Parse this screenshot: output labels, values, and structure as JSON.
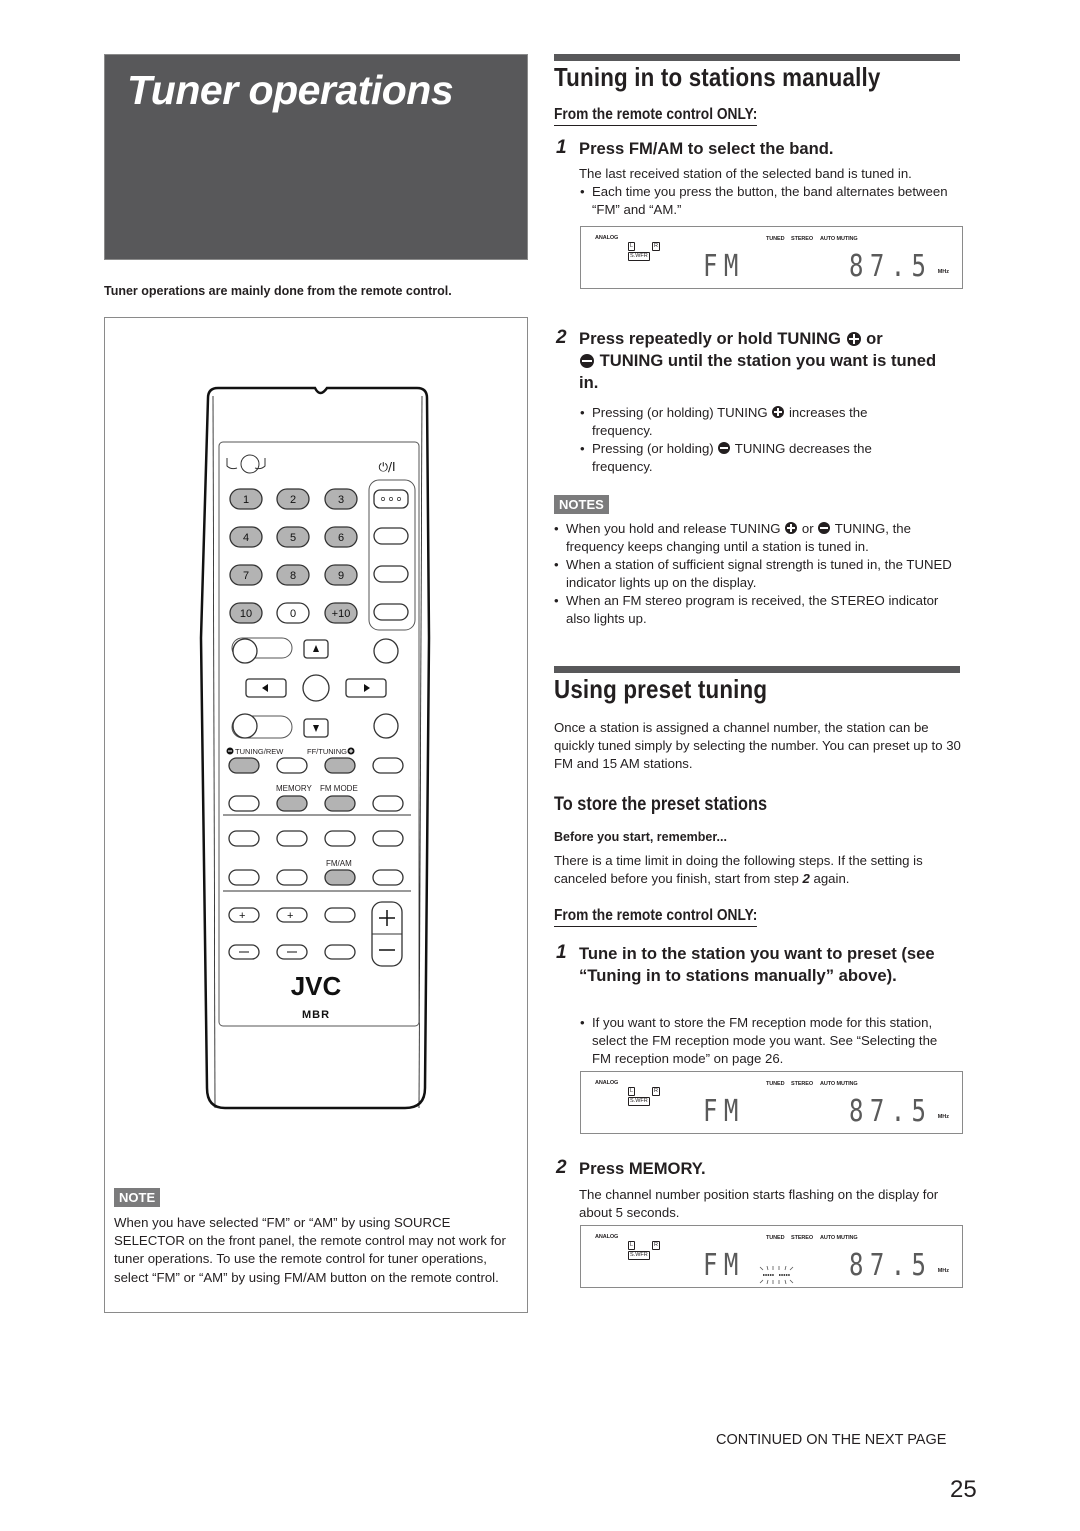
{
  "chapter": {
    "title": "Tuner operations",
    "caption": "Tuner operations are mainly done from the remote control."
  },
  "remote": {
    "power_label": "⏻/I",
    "numeric_keys": [
      "1",
      "2",
      "3",
      "4",
      "5",
      "6",
      "7",
      "8",
      "9",
      "10",
      "0",
      "+10"
    ],
    "labels": {
      "tuning_rew": "TUNING/REW",
      "ff_tuning": "FF/TUNING",
      "memory": "MEMORY",
      "fm_mode": "FM MODE",
      "fm_am": "FM/AM"
    },
    "brand": "JVC",
    "sub_brand": "MBR"
  },
  "remote_note": {
    "label": "NOTE",
    "text": "When you have selected “FM” or “AM” by using SOURCE SELECTOR on the front panel, the remote control may not work for tuner operations. To use the remote control for tuner operations, select “FM” or “AM” by using FM/AM button on the remote control."
  },
  "manual": {
    "heading": "Tuning in to stations manually",
    "subheading": "From the remote control ONLY:",
    "step1": {
      "num": "1",
      "title": "Press FM/AM to select the band.",
      "body": "The last received station of the selected band is tuned in.",
      "bullet": "Each time you press the button, the band alternates between “FM” and “AM.”"
    },
    "step2": {
      "num": "2",
      "title_a": "Press repeatedly or hold TUNING",
      "title_b": "or",
      "title_c": "TUNING until the station you want is tuned in.",
      "bullet1_a": "Pressing (or holding) TUNING",
      "bullet1_b": "increases the frequency.",
      "bullet2_a": "Pressing (or holding)",
      "bullet2_b": "TUNING decreases the frequency."
    },
    "notes_label": "NOTES",
    "notes": {
      "n1_a": "When you hold and release TUNING",
      "n1_b": "or",
      "n1_c": "TUNING, the frequency keeps changing until a station is tuned in.",
      "n2": "When a station of sufficient signal strength is tuned in, the TUNED indicator lights up on the display.",
      "n3": "When an FM stereo program is received, the STEREO indicator also lights up."
    }
  },
  "display": {
    "analog": "ANALOG",
    "l": "L",
    "r": "R",
    "swfr": "S.WFR",
    "tuned": "TUNED",
    "stereo": "STEREO",
    "auto_muting": "AUTO MUTING",
    "band": "FM",
    "frequency": "87.5",
    "unit": "MHz"
  },
  "preset": {
    "heading": "Using preset tuning",
    "intro": "Once a station is assigned a channel number, the station can be quickly tuned simply by selecting the number. You can preset up to 30 FM and 15 AM stations.",
    "store_heading": "To store the preset stations",
    "before_label": "Before you start, remember...",
    "before_text_a": "There is a time limit in doing the following steps. If the setting is canceled before you finish, start from step",
    "before_step": "2",
    "before_text_b": "again.",
    "subheading": "From the remote control ONLY:",
    "step1": {
      "num": "1",
      "title": "Tune in to the station you want to preset (see “Tuning in to stations manually” above).",
      "bullet": "If you want to store the FM reception mode for this station, select the FM reception mode you want. See “Selecting the FM reception mode” on page 26."
    },
    "step2": {
      "num": "2",
      "title": "Press MEMORY.",
      "body": "The channel number position starts flashing on the display for about 5 seconds."
    }
  },
  "footer": {
    "continued": "CONTINUED ON THE NEXT PAGE",
    "page_number": "25"
  }
}
